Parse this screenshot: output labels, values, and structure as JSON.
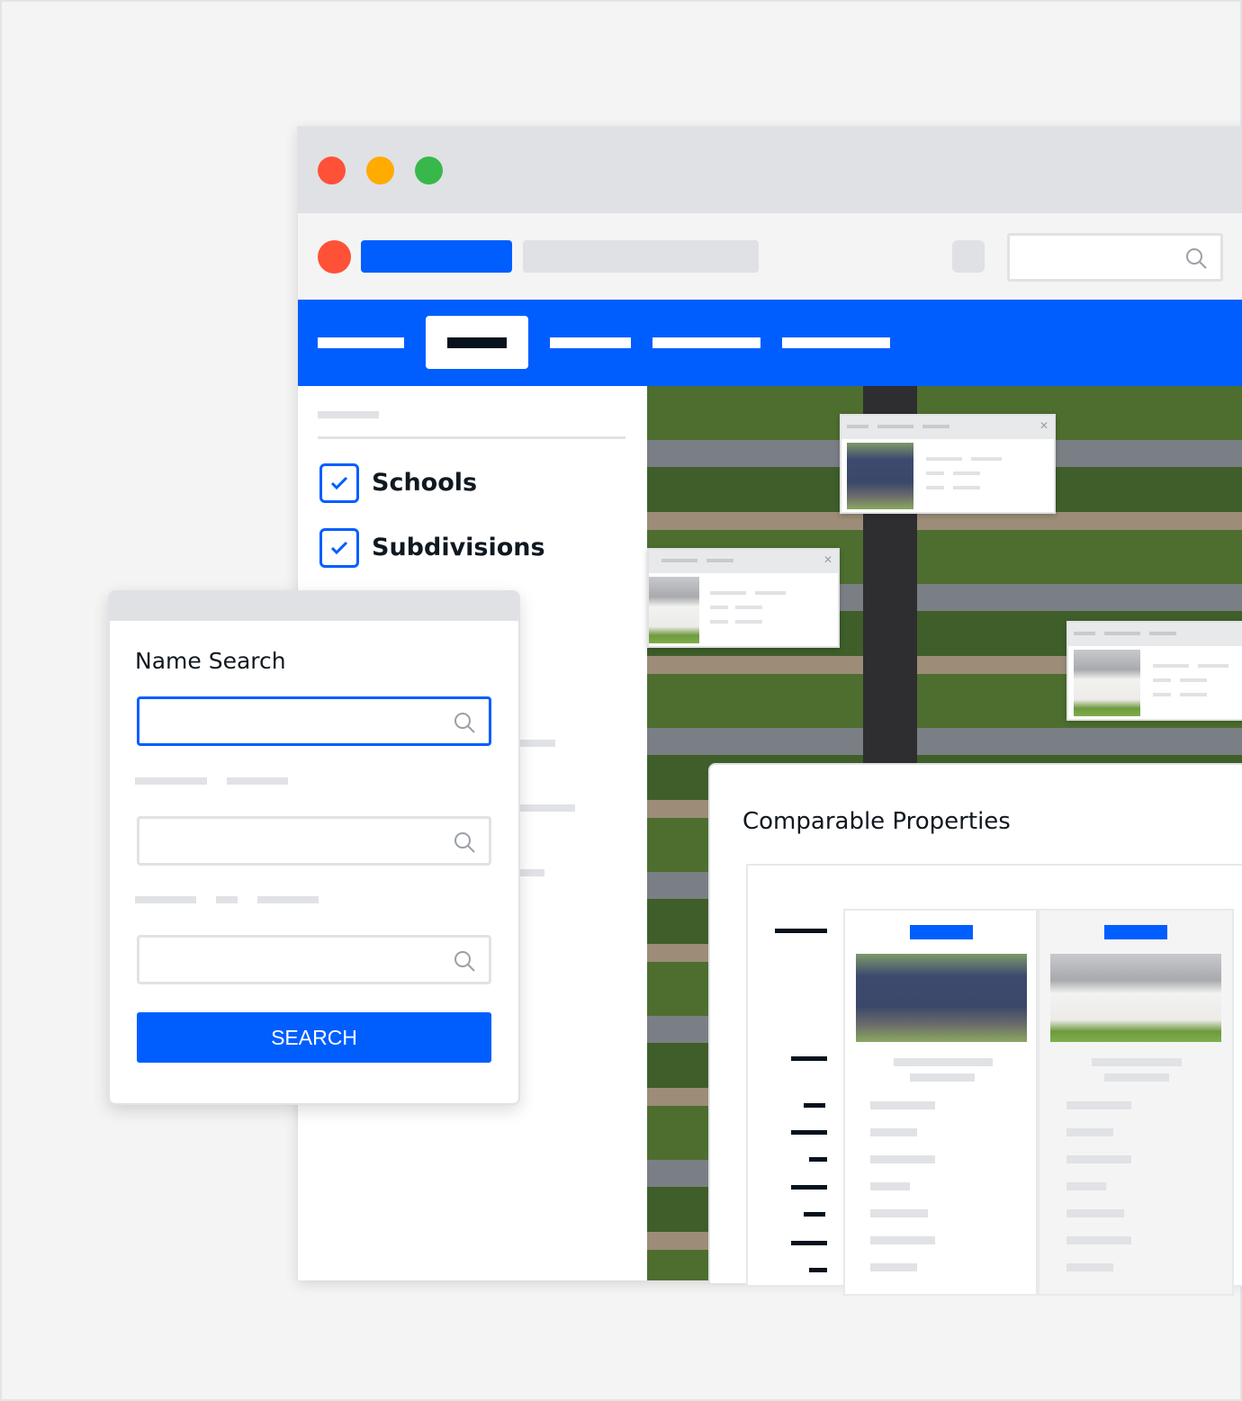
{
  "colors": {
    "accent": "#005eff",
    "close": "#ff5138",
    "minimize": "#ffab00",
    "maximize": "#38b84a",
    "skeleton": "#e0e2e5",
    "text": "#101820"
  },
  "window_controls": [
    "close",
    "minimize",
    "maximize"
  ],
  "filters": [
    {
      "label": "Schools",
      "checked": true
    },
    {
      "label": "Subdivisions",
      "checked": true
    }
  ],
  "name_search": {
    "title": "Name Search",
    "search_button": "SEARCH",
    "icon": "search-icon"
  },
  "comparable": {
    "title": "Comparable Properties"
  }
}
